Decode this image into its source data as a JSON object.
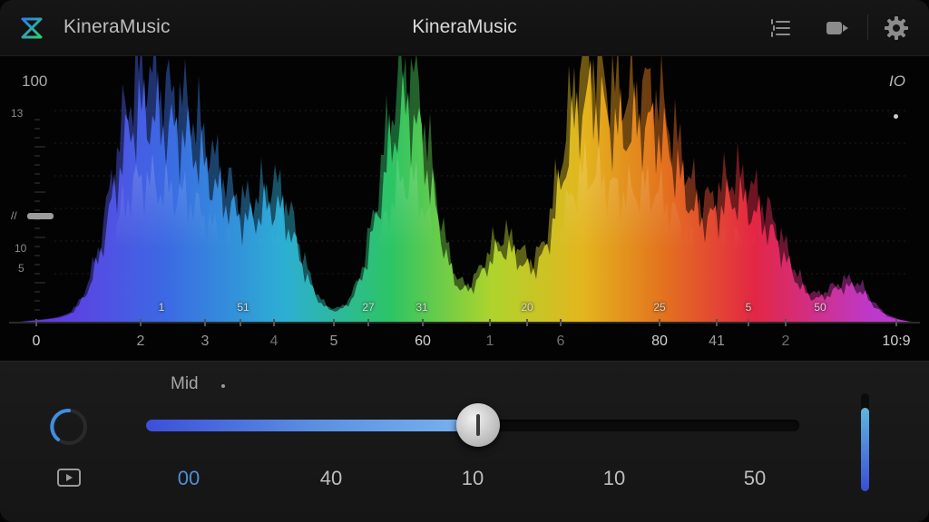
{
  "header": {
    "app_name": "KineraMusic",
    "title": "KineraMusic",
    "icons": [
      "equalizer-list-icon",
      "audio-output-icon",
      "gear-icon"
    ]
  },
  "spectrum": {
    "top_label": "100",
    "right_label": "IO",
    "y_labels": [
      "13",
      "10",
      "5"
    ],
    "marker_hint": "//",
    "x_labels": [
      "0",
      "2",
      "3",
      "4",
      "5",
      "60",
      "1",
      "6",
      "80",
      "41",
      "2",
      "10:9"
    ],
    "peak_labels": [
      "1",
      "51",
      "27",
      "31",
      "20",
      "25",
      "5",
      "50"
    ],
    "colors": [
      "#6a3cf0",
      "#3f6ff0",
      "#2fb8e0",
      "#2fd06a",
      "#b8e02f",
      "#f0c020",
      "#f07820",
      "#f02848",
      "#c83cd8"
    ]
  },
  "controls": {
    "band_label": "Mid",
    "ticks": [
      "00",
      "40",
      "10",
      "10",
      "50"
    ],
    "slider_value": 0.51,
    "level_meter": 0.85,
    "accent": "#4f8fd8"
  }
}
